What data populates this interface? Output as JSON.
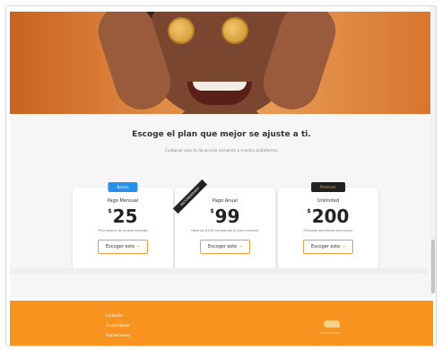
{
  "headline": "Escoge el plan que mejor se ajuste a ti.",
  "subheadline": "Cualquier plan te da acceso completo a nuestra plataforma.",
  "plans": [
    {
      "badge": "Basico",
      "title": "Pago Mensual",
      "currency": "$",
      "price": "25",
      "description": "*Plan básico de acceso limitado.",
      "button": "Escoger este"
    },
    {
      "ribbon": "RECOMENDADO",
      "title": "Pago Anual",
      "currency": "$",
      "price": "99",
      "description": "*Ahorras $100 comparado al plan mensual.",
      "button": "Escoger este"
    },
    {
      "badge": "Premium",
      "title": "Unlimited",
      "currency": "$",
      "price": "200",
      "description": "*Grandes beneficios exclusivos.",
      "button": "Escoger este"
    }
  ],
  "footer": {
    "links": [
      "Linkedin",
      "Crunchbase",
      "Hackernews"
    ],
    "logo_caption": "Criptomonedas"
  },
  "icons": {
    "button_arrow": "arrow-right-icon"
  },
  "colors": {
    "accent": "#f7931e",
    "badge_basic": "#2a8fe6",
    "badge_premium": "#222222"
  }
}
